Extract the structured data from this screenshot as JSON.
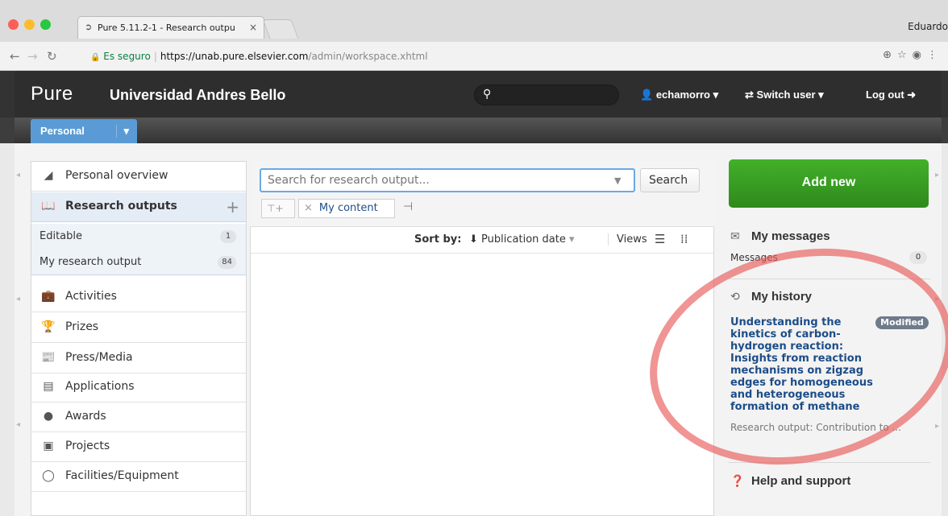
{
  "browser": {
    "tab_title": "Pure 5.11.2-1 - Research outpu",
    "tab_close": "×",
    "profile_name": "Eduardo",
    "url_secure": "Es seguro",
    "url_host": "https://unab.pure.elsevier.com",
    "url_path": "/admin/workspace.xhtml",
    "icons": [
      "back-icon",
      "forward-icon",
      "reload-icon",
      "lock-icon",
      "zoom-icon",
      "star-icon"
    ]
  },
  "header": {
    "logo": "Pure",
    "org_name": "Universidad Andres Bello",
    "user": "echamorro",
    "switch_user": "Switch user",
    "logout": "Log out"
  },
  "tabs": {
    "personal": "Personal"
  },
  "leftnav": {
    "items": [
      {
        "label": "Personal overview",
        "icon": "person-overview-icon"
      },
      {
        "label": "Research outputs",
        "icon": "book-icon"
      },
      {
        "label": "Activities",
        "icon": "briefcase-icon"
      },
      {
        "label": "Prizes",
        "icon": "trophy-icon"
      },
      {
        "label": "Press/Media",
        "icon": "newspaper-icon"
      },
      {
        "label": "Applications",
        "icon": "applications-icon"
      },
      {
        "label": "Awards",
        "icon": "award-icon"
      },
      {
        "label": "Projects",
        "icon": "box-icon"
      },
      {
        "label": "Facilities/Equipment",
        "icon": "equipment-icon"
      }
    ],
    "sub_items": [
      {
        "label": "Editable",
        "count": "1"
      },
      {
        "label": "My research output",
        "count": "84"
      }
    ]
  },
  "main": {
    "search_placeholder": "Search for research output...",
    "search_button": "Search",
    "filter_chip": "My content",
    "sort_label": "Sort by:",
    "sort_value": "Publication date",
    "views_label": "Views"
  },
  "right": {
    "add_new": "Add new",
    "messages_title": "My messages",
    "messages_label": "Messages",
    "messages_count": "0",
    "history_title": "My history",
    "history_item_title": "Understanding the kinetics of carbon-hydrogen reaction: Insights from reaction mechanisms on zigzag edges for homogeneous and heterogeneous formation of methane",
    "history_item_status": "Modified",
    "history_item_meta": "Research output: Contribution to ...",
    "help_title": "Help and support"
  },
  "colors": {
    "header_bg": "#2e2e2e",
    "accent_blue": "#5b9bd5",
    "add_new_green": "#3a9e24",
    "link_blue": "#1d4d88",
    "annotation_red": "#e85a5a"
  }
}
